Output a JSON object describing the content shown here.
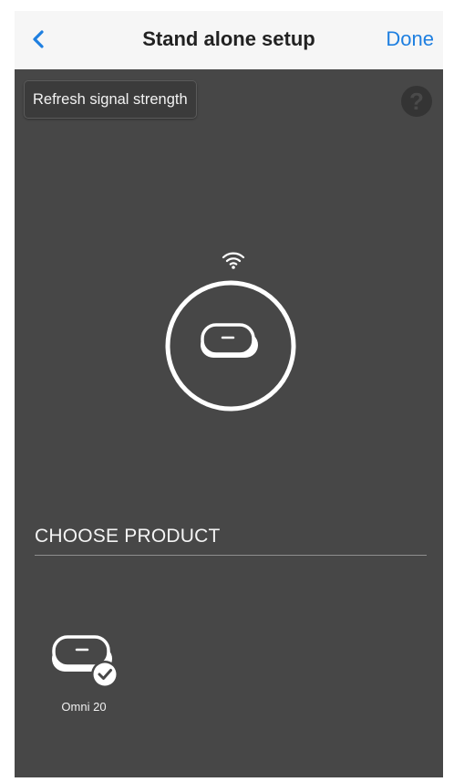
{
  "nav": {
    "back_icon": "chevron-left-icon",
    "title": "Stand alone setup",
    "done_label": "Done",
    "accent_color": "#1e7fe0"
  },
  "toolbar": {
    "refresh_label": "Refresh signal strength",
    "help_label": "?",
    "help_icon": "question-circle-icon"
  },
  "device": {
    "signal_icon": "wifi-icon",
    "device_icon": "omni-device-icon"
  },
  "products": {
    "header": "CHOOSE PRODUCT",
    "items": [
      {
        "label": "Omni 20",
        "selected": true,
        "icon": "omni-device-icon"
      }
    ]
  }
}
